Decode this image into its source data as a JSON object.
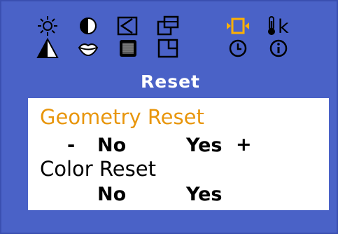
{
  "menu": {
    "icons_row1": [
      "brightness-icon",
      "contrast-icon",
      "position-icon",
      "size-icon",
      "reset-icon",
      "color-temperature-icon"
    ],
    "icons_row2": [
      "sharpness-icon",
      "hue-icon",
      "clock-phase-icon",
      "window-icon",
      "timer-icon",
      "information-icon"
    ],
    "selected_icon": "reset-icon",
    "color_temp_label": "k"
  },
  "section": {
    "title": "Reset"
  },
  "geometry_reset": {
    "label": "Geometry Reset",
    "minus": "-",
    "no": "No",
    "yes": "Yes",
    "plus": "+"
  },
  "color_reset": {
    "label": "Color Reset",
    "no": "No",
    "yes": "Yes"
  },
  "colors": {
    "background": "#4a62c7",
    "highlight": "#e8960c",
    "icon": "#000000",
    "selected_icon": "#ffb000"
  }
}
